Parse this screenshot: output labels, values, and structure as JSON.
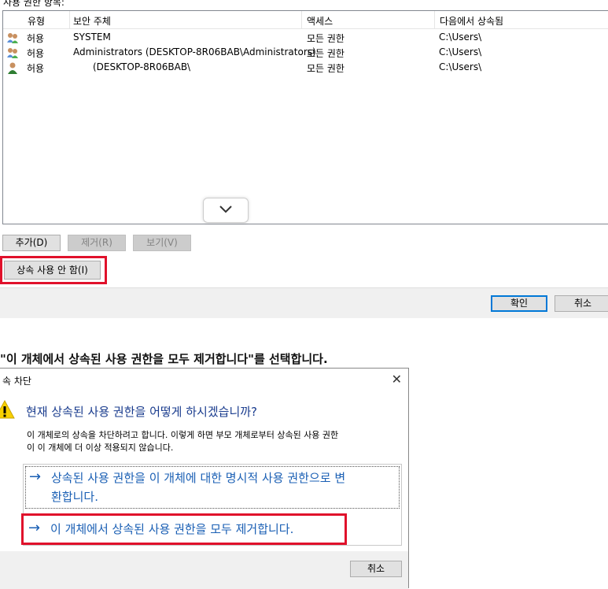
{
  "permissions": {
    "list_label": "사용 권한 항목:",
    "columns": [
      "유형",
      "보안 주체",
      "액세스",
      "다음에서 상속됨"
    ],
    "rows": [
      {
        "type": "허용",
        "principal": "SYSTEM",
        "access": "모든 권한",
        "inherited": "C:\\Users\\",
        "icon": "group-users-icon"
      },
      {
        "type": "허용",
        "principal": "Administrators (DESKTOP-8R06BAB\\Administrators)",
        "access": "모든 권한",
        "inherited": "C:\\Users\\",
        "icon": "group-users-icon"
      },
      {
        "type": "허용",
        "principal": "(DESKTOP-8R06BAB\\",
        "access": "모든 권한",
        "inherited": "C:\\Users\\",
        "icon": "user-icon"
      }
    ],
    "buttons": {
      "add": "추가(D)",
      "remove": "제거(R)",
      "view": "보기(V)",
      "disable_inheritance": "상속 사용 안 함(I)"
    },
    "ok": "확인",
    "cancel": "취소"
  },
  "caption": "\"이 개체에서 상속된 사용 권한을 모두 제거합니다\"를 선택합니다.",
  "dialog": {
    "title": "속 차단",
    "heading": "현재 상속된 사용 권한을 어떻게 하시겠습니까?",
    "body_line1": "이 개체로의 상속을 차단하려고 합니다. 이렇게 하면 부모 개체로부터 상속된 사용 권한",
    "body_line2": "이 이 개체에 더 이상 적용되지 않습니다.",
    "option1_line1": "상속된 사용 권한을 이 개체에 대한 명시적 사용 권한으로 변",
    "option1_line2": "환합니다.",
    "option2": "이 개체에서 상속된 사용 권한을 모두 제거합니다.",
    "cancel": "취소"
  },
  "colors": {
    "highlight_red": "#e0112b",
    "link_blue": "#1a5fb4",
    "heading_blue": "#1a3c8e"
  }
}
